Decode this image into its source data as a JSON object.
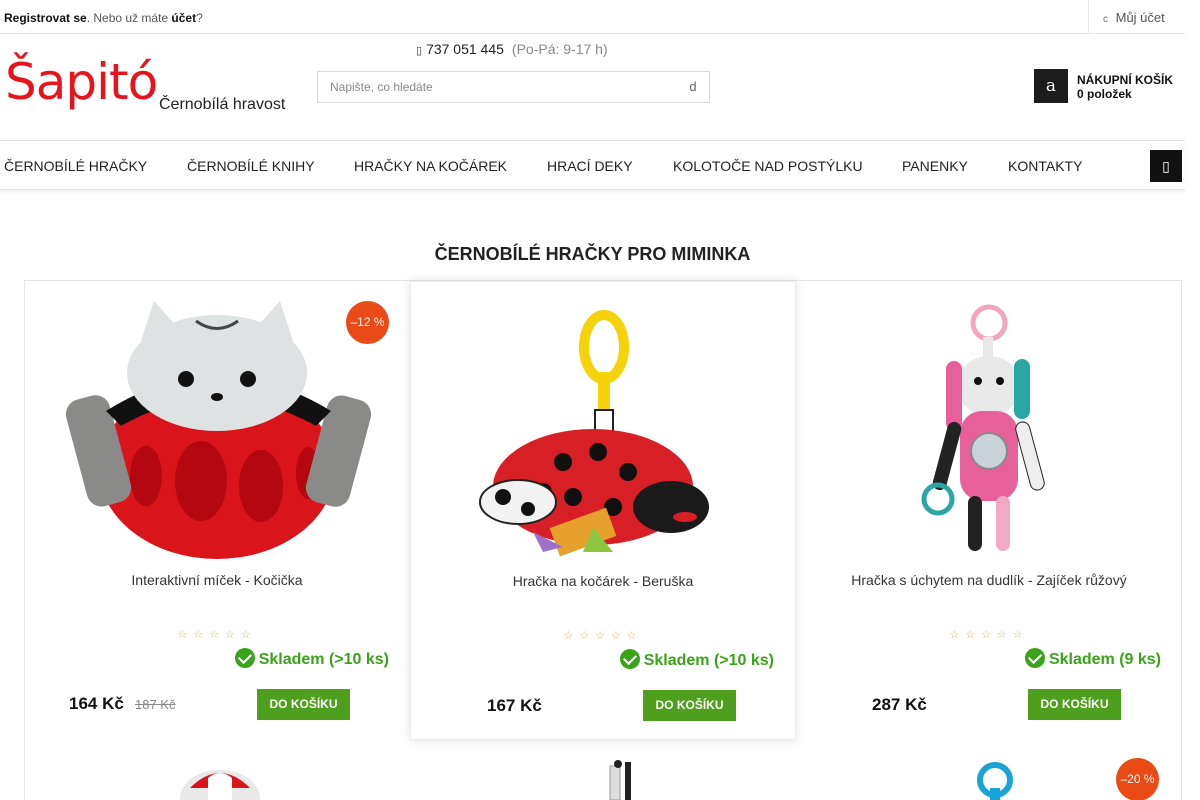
{
  "topbar": {
    "register": "Registrovat se",
    "middle": ". Nebo už máte ",
    "account_link": "účet",
    "end": "?",
    "my_account_icon": "user-icon",
    "my_account": "Můj účet"
  },
  "header": {
    "phone_icon": "phone-icon",
    "phone": "737 051 445",
    "hours": "(Po-Pá: 9-17 h)",
    "logo_text": "Šapitó",
    "tagline": "Černobílá hravost",
    "search_placeholder": "Napište, co hledáte",
    "search_icon": "search-icon",
    "cart_icon": "cart-icon",
    "cart_title": "NÁKUPNÍ KOŠÍK",
    "cart_count": "0 položek"
  },
  "nav": {
    "items": [
      "ČERNOBÍLÉ HRAČKY",
      "ČERNOBÍLÉ KNIHY",
      "HRAČKY NA KOČÁREK",
      "HRACÍ DEKY",
      "KOLOTOČE NAD POSTÝLKU",
      "PANENKY",
      "KONTAKTY"
    ],
    "menu_icon": "chevron-down-icon"
  },
  "section_title": "ČERNOBÍLÉ HRAČKY PRO MIMINKA",
  "products": [
    {
      "name": "Interaktivní míček - Kočička",
      "stars": "☆☆☆☆☆",
      "stock_label": "Skladem",
      "stock_count": "(>10 ks)",
      "price": "164 Kč",
      "old_price": "187 Kč",
      "buy": "DO KOŠÍKU",
      "badge": "–12 %"
    },
    {
      "name": "Hračka na kočárek - Beruška",
      "stars": "☆☆☆☆☆",
      "stock_label": "Skladem",
      "stock_count": "(>10 ks)",
      "price": "167 Kč",
      "buy": "DO KOŠÍKU"
    },
    {
      "name": "Hračka s úchytem na dudlík - Zajíček růžový",
      "stars": "☆☆☆☆☆",
      "stock_label": "Skladem",
      "stock_count": "(9 ks)",
      "price": "287 Kč",
      "buy": "DO KOŠÍKU"
    }
  ],
  "second_row": {
    "badge": "–20 %"
  },
  "colors": {
    "brand_red": "#e8141c",
    "badge_orange": "#ea4a15",
    "buy_green": "#4d9f1d",
    "stock_green": "#3aa31a"
  }
}
